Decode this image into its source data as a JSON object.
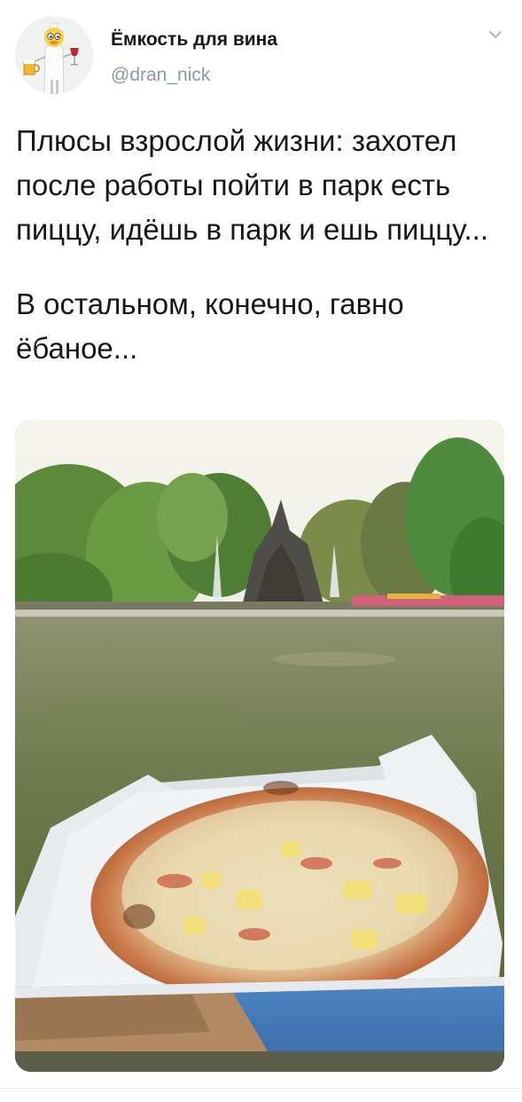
{
  "tweet": {
    "author": {
      "display_name": "Ёмкость для вина",
      "handle": "@dran_nick"
    },
    "text_paragraph_1": "Плюсы взрослой жизни: захотел после работы пойти в парк есть пиццу, идёшь в парк и ешь пиццу...",
    "text_paragraph_2": "В остальном, конечно, гавно ёбаное..."
  },
  "colors": {
    "text": "#14171a",
    "handle": "#8b98a5",
    "divider": "#e6ecf0"
  },
  "icons": {
    "menu": "chevron-down-icon",
    "avatar": "duck-bottle-avatar"
  }
}
